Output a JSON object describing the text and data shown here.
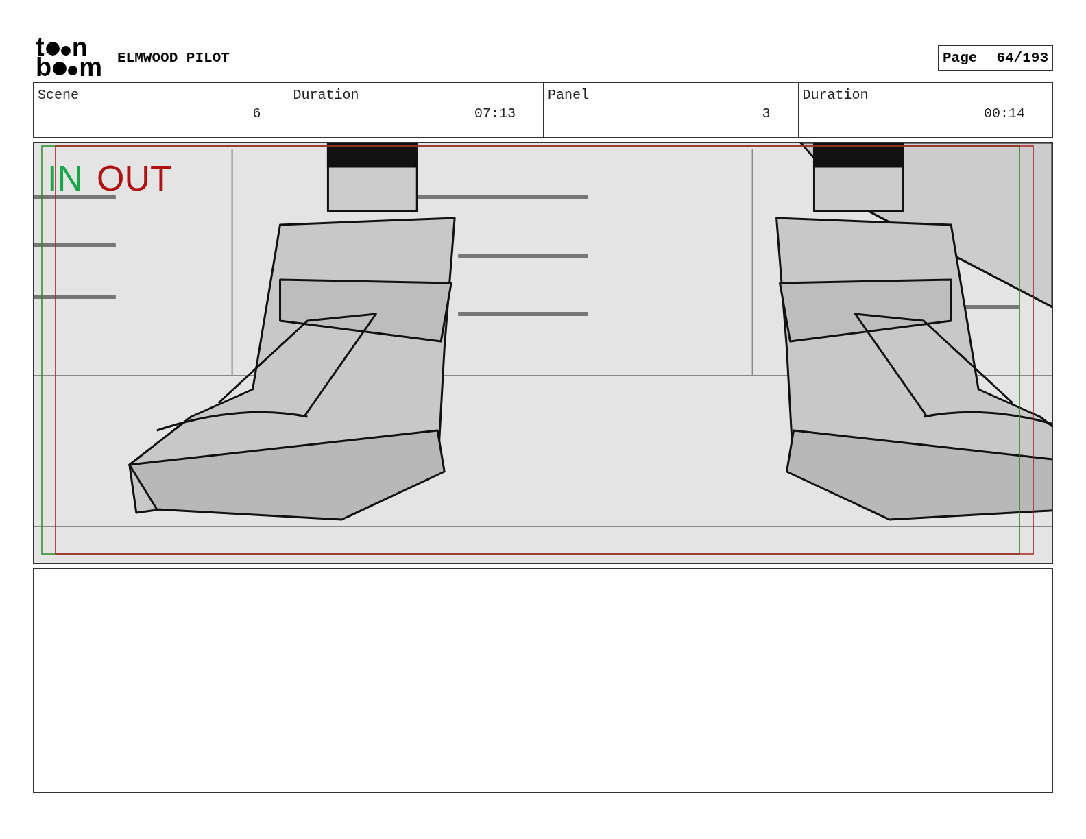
{
  "logo": [
    {
      "before": "t",
      "after": "n"
    },
    {
      "before": "b",
      "after": "m"
    }
  ],
  "project_title": "ELMWOOD PILOT",
  "page": {
    "label": "Page",
    "value": "64/193"
  },
  "info": [
    {
      "label": "Scene",
      "value": "6"
    },
    {
      "label": "Duration",
      "value": "07:13"
    },
    {
      "label": "Panel",
      "value": "3"
    },
    {
      "label": "Duration",
      "value": "00:14"
    }
  ],
  "panel": {
    "in_label": "IN",
    "out_label": "OUT"
  }
}
